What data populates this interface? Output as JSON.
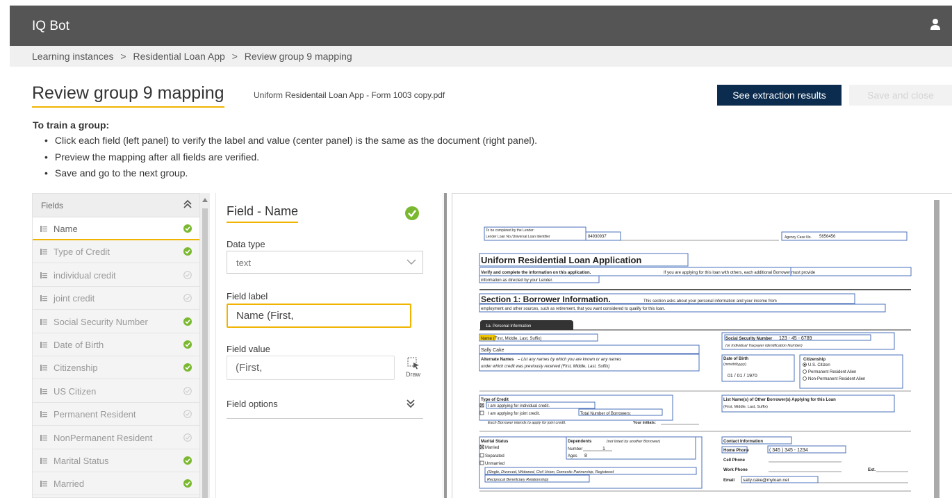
{
  "app": {
    "title": "IQ Bot"
  },
  "icons": {
    "user": "user-icon",
    "collapse": "double-chevron-up-icon",
    "row": "list-lines-icon",
    "verified": "check-circle-icon",
    "unverified": "check-circle-outline-icon",
    "select": "chevron-down-icon",
    "draw": "draw-select-icon",
    "expand": "double-chevron-down-icon"
  },
  "colors": {
    "accent": "#f0b400",
    "primary_button": "#0c2c4f",
    "verified_green": "#7ab82f",
    "topbar": "#555555"
  },
  "breadcrumb": {
    "items": [
      "Learning instances",
      "Residential Loan App",
      "Review group 9 mapping"
    ],
    "separator": ">"
  },
  "header": {
    "title": "Review group 9 mapping",
    "file_name": "Uniform Residentail Loan App - Form 1003 copy.pdf",
    "see_results_label": "See extraction results",
    "save_close_label": "Save and close"
  },
  "instructions": {
    "title": "To train a group:",
    "items": [
      "Click each field (left panel) to verify the label and value (center panel) is the same as the document (right panel).",
      "Preview the mapping after all fields are verified.",
      "Save and go to the next group."
    ]
  },
  "fields_panel": {
    "header": "Fields",
    "items": [
      {
        "label": "Name",
        "verified": true,
        "active": true
      },
      {
        "label": "Type of Credit",
        "verified": true
      },
      {
        "label": "individual credit",
        "verified": false
      },
      {
        "label": "joint credit",
        "verified": false
      },
      {
        "label": "Social Security Number",
        "verified": true
      },
      {
        "label": "Date of Birth",
        "verified": true
      },
      {
        "label": "Citizenship",
        "verified": true
      },
      {
        "label": "US Citizen",
        "verified": false
      },
      {
        "label": "Permanent Resident",
        "verified": false
      },
      {
        "label": "NonPermanent Resident",
        "verified": false
      },
      {
        "label": "Marital Status",
        "verified": true
      },
      {
        "label": "Married",
        "verified": true
      }
    ]
  },
  "field_detail": {
    "title": "Field - Name",
    "data_type_label": "Data type",
    "data_type_value": "text",
    "field_label_label": "Field label",
    "field_label_value": "Name (First,",
    "field_value_label": "Field value",
    "field_value_value": "(First,",
    "draw_label": "Draw",
    "field_options_label": "Field options"
  },
  "document": {
    "lender_header": [
      "To be completed by the Lender:",
      "Lender Loan No./Universal Loan Identifier"
    ],
    "loan_no": "84930937",
    "agency_case_label": "Agency Case No.",
    "agency_case_value": "5656456",
    "form_title": "Uniform Residential Loan Application",
    "form_intro_bold": "Verify and complete the information on this application.",
    "form_intro_rest": "If you are applying for this loan with others, each additional Borrower must provide",
    "form_intro_line2": "information as directed by your Lender.",
    "section_title": "Section 1: Borrower Information.",
    "section_intro_1": "This section asks about your personal information and your income from",
    "section_intro_2": "employment and other sources, such as retirement, that you want considered to qualify for this loan.",
    "tab_label": "1a. Personal Information",
    "name_label": "Name (First, Middle, Last, Suffix)",
    "name_value": "Sally Cake",
    "alt_names_label": "Alternate Names",
    "alt_names_text": "– List any names by which you are known or any names",
    "alt_names_text2": "under which credit was previously received (First, Middle, Last, Suffix)",
    "ssn_label": "Social Security Number",
    "ssn_value": "123  -  45  -  6789",
    "ssn_note": "(or Individual Taxpayer Identification Number)",
    "dob_label": "Date of Birth",
    "dob_format": "(mm/dd/yyyy)",
    "dob_value": "01  /  01  /  1970",
    "citizenship_label": "Citizenship",
    "citizenship_options": [
      "U.S. Citizen",
      "Permanent Resident Alien",
      "Non-Permanent Resident Alien"
    ],
    "credit_label": "Type of Credit",
    "credit_opt1": "I am applying for individual credit.",
    "credit_opt2": "I am applying for joint credit.",
    "credit_total": "Total Number of Borrowers:",
    "credit_note": "Each Borrower intends to apply for joint credit.",
    "credit_initials": "Your initials:",
    "other_borrowers_label": "List Name(s) of Other Borrower(s) Applying for this Loan",
    "other_borrowers_sub": "(First, Middle, Last, Suffix)",
    "marital_label": "Marital Status",
    "marital_options": [
      "Married",
      "Separated",
      "Unmarried"
    ],
    "marital_note": "(Single, Divorced, Widowed, Civil Union, Domestic Partnership, Registered",
    "marital_note2": "Reciprocal Beneficiary Relationship)",
    "dependents_label": "Dependents",
    "dependents_note": "(not listed by another Borrower)",
    "dependents_number": "Number",
    "dependents_number_value": "1",
    "dependents_ages": "Ages",
    "dependents_ages_value": "8",
    "contact_label": "Contact Information",
    "home_phone_label": "Home Phone",
    "home_phone_value": "( 345 ) 345  -  1234",
    "cell_phone_label": "Cell Phone",
    "work_phone_label": "Work Phone",
    "ext_label": "Ext.",
    "email_label": "Email",
    "email_value": "sally.cake@myloan.net"
  }
}
